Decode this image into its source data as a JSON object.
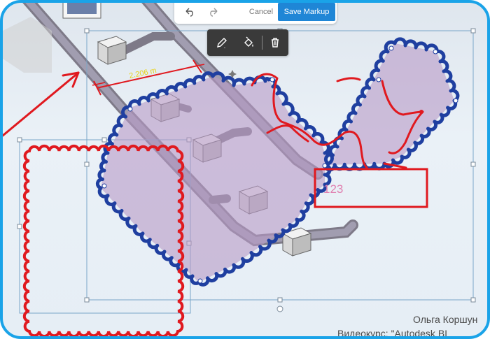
{
  "toolbar": {
    "undo_icon": "undo-icon",
    "redo_icon": "redo-icon",
    "cancel_label": "Cancel",
    "save_label": "Save Markup"
  },
  "markup_tools": {
    "pen_icon": "pen-icon",
    "fill_icon": "fill-bucket-icon",
    "delete_icon": "trash-icon"
  },
  "canvas": {
    "dimension_label": "2.206 m",
    "text_markup_value": "123"
  },
  "caption": {
    "line1": "Ольга Коршун",
    "line2": "Видеокурс: \"Autodesk BI"
  },
  "colors": {
    "frame": "#1aa3e8",
    "save_button": "#1f86d6",
    "cloud_stroke": "#1f3fa0",
    "cloud_fill": "#b89ac6",
    "markup_red": "#e0191f",
    "dimension_yellow": "#e8d21a"
  }
}
